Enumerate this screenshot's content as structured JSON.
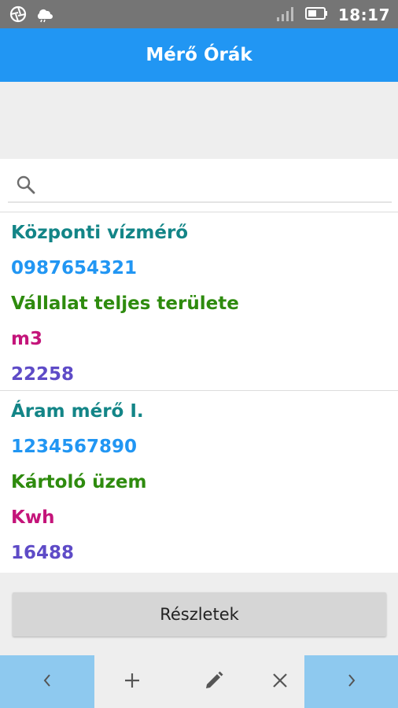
{
  "status_bar": {
    "time": "18:17",
    "icons": [
      "aperture-icon",
      "weather-icon",
      "signal-icon",
      "battery-icon"
    ]
  },
  "app_bar": {
    "title": "Mérő Órák"
  },
  "search": {
    "placeholder": "",
    "value": ""
  },
  "meters": [
    {
      "name": "Központi vízmérő",
      "serial": "0987654321",
      "location": "Vállalat teljes területe",
      "unit": "m3",
      "value": "22258"
    },
    {
      "name": "Áram mérő I.",
      "serial": "1234567890",
      "location": "Kártoló üzem",
      "unit": "Kwh",
      "value": "16488"
    }
  ],
  "actions": {
    "details_label": "Részletek"
  },
  "toolbar": {
    "icons": [
      "chevron-left-icon",
      "plus-icon",
      "pencil-icon",
      "close-icon",
      "chevron-right-icon"
    ]
  },
  "colors": {
    "app_bar": "#2196f3",
    "status_bar": "#757575",
    "name": "#138587",
    "serial": "#2196f3",
    "location": "#2e8b0e",
    "unit": "#c4147a",
    "value": "#5e4bc7",
    "nav_button": "#8ec9ef"
  }
}
